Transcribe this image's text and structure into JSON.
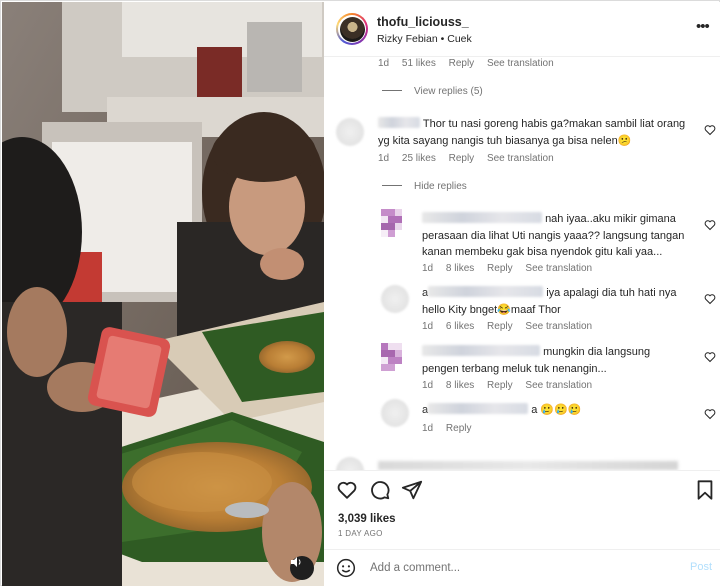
{
  "post": {
    "username": "thofu_liciouss_",
    "audio_artist": "Rizky Febian",
    "audio_separator": "•",
    "audio_song": "Cuek",
    "more_label": "•••"
  },
  "comments": {
    "first_meta": {
      "time": "1d",
      "likes": "51 likes",
      "reply": "Reply",
      "translate": "See translation"
    },
    "view_replies": "View replies (5)",
    "main_comment": {
      "line1": "Thor tu nasi goreng habis ga?makan sambil liat orang",
      "line2": "yg kita sayang nangis tuh biasanya ga bisa nelen😕",
      "time": "1d",
      "likes": "25 likes",
      "reply": "Reply",
      "translate": "See translation"
    },
    "hide_replies": "Hide replies",
    "replies": [
      {
        "line1_visible": "nah iyaa..aku mikir gimana",
        "line2": "perasaan dia lihat Uti nangis yaaa?? langsung tangan",
        "line3": "kanan membeku gak bisa nyendok gitu kali yaa...",
        "time": "1d",
        "likes": "8 likes",
        "reply": "Reply",
        "translate": "See translation"
      },
      {
        "prefix": "a",
        "line1_visible": "iya apalagi dia tuh hati nya",
        "line2": "hello Kity bnget😂maaf Thor",
        "time": "1d",
        "likes": "6 likes",
        "reply": "Reply",
        "translate": "See translation"
      },
      {
        "line1_visible": "mungkin dia langsung",
        "line2": "pengen terbang meluk tuk nenangin...",
        "time": "1d",
        "likes": "8 likes",
        "reply": "Reply",
        "translate": "See translation"
      },
      {
        "prefix": "a",
        "line1_visible": "a 🥲🥲🥲",
        "time": "1d",
        "reply": "Reply"
      }
    ]
  },
  "footer": {
    "likes_count": "3,039 likes",
    "date": "1 DAY AGO",
    "comment_placeholder": "Add a comment...",
    "post_label": "Post"
  },
  "colors": {
    "text": "#262626",
    "secondary": "#737373",
    "post_disabled": "#b2dffc",
    "leaf_green": "#2f5b23"
  }
}
